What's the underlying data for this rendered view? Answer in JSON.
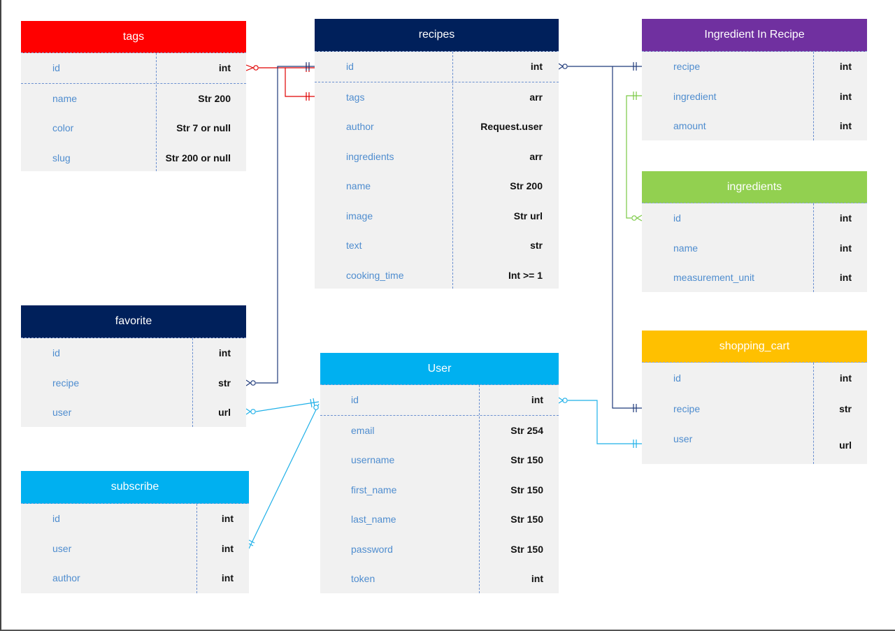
{
  "tables": {
    "tags": {
      "title": "tags",
      "color": "#ff0000",
      "fields": [
        {
          "name": "id",
          "type": "int"
        },
        {
          "name": "name",
          "type": "Str 200"
        },
        {
          "name": "color",
          "type": "Str 7 or null"
        },
        {
          "name": "slug",
          "type": "Str 200 or null"
        }
      ]
    },
    "recipes": {
      "title": "recipes",
      "color": "#00205b",
      "fields": [
        {
          "name": "id",
          "type": "int"
        },
        {
          "name": "tags",
          "type": "arr"
        },
        {
          "name": "author",
          "type": "Request.user"
        },
        {
          "name": "ingredients",
          "type": "arr"
        },
        {
          "name": "name",
          "type": "Str 200"
        },
        {
          "name": "image",
          "type": "Str url"
        },
        {
          "name": "text",
          "type": "str"
        },
        {
          "name": "cooking_time",
          "type": "Int >= 1"
        }
      ]
    },
    "ingredient_in_recipe": {
      "title": "Ingredient In Recipe",
      "color": "#7030a0",
      "fields": [
        {
          "name": "recipe",
          "type": "int"
        },
        {
          "name": "ingredient",
          "type": "int"
        },
        {
          "name": "amount",
          "type": "int"
        }
      ]
    },
    "ingredients": {
      "title": "ingredients",
      "color": "#92d050",
      "fields": [
        {
          "name": "id",
          "type": "int"
        },
        {
          "name": "name",
          "type": "int"
        },
        {
          "name": "measurement_unit",
          "type": "int"
        }
      ]
    },
    "favorite": {
      "title": "favorite",
      "color": "#00205b",
      "fields": [
        {
          "name": "id",
          "type": "int"
        },
        {
          "name": "recipe",
          "type": "str"
        },
        {
          "name": "user",
          "type": "url"
        }
      ]
    },
    "user": {
      "title": "User",
      "color": "#00b0f0",
      "fields": [
        {
          "name": "id",
          "type": "int"
        },
        {
          "name": "email",
          "type": "Str 254"
        },
        {
          "name": "username",
          "type": "Str 150"
        },
        {
          "name": "first_name",
          "type": "Str 150"
        },
        {
          "name": "last_name",
          "type": "Str 150"
        },
        {
          "name": "password",
          "type": "Str 150"
        },
        {
          "name": "token",
          "type": "int"
        }
      ]
    },
    "shopping_cart": {
      "title": "shopping_cart",
      "color": "#ffc000",
      "fields": [
        {
          "name": "id",
          "type": "int"
        },
        {
          "name": "recipe",
          "type": "str"
        },
        {
          "name": "user",
          "type": "url"
        }
      ]
    },
    "subscribe": {
      "title": "subscribe",
      "color": "#00b0f0",
      "fields": [
        {
          "name": "id",
          "type": "int"
        },
        {
          "name": "user",
          "type": "int"
        },
        {
          "name": "author",
          "type": "int"
        }
      ]
    }
  },
  "connector_colors": {
    "tags_recipes": "#e00000",
    "recipes_links": "#1f3a7a",
    "ingredient_link": "#7ac943",
    "user_links": "#1fb0e8"
  }
}
